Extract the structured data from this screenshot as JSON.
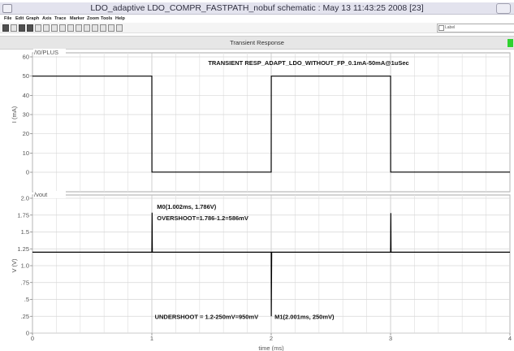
{
  "window": {
    "title": "LDO_adaptive LDO_COMPR_FASTPATH_nobuf schematic : May 13 11:43:25 2008 [23]"
  },
  "menu": [
    "File",
    "Edit",
    "Graph",
    "Axis",
    "Trace",
    "Marker",
    "Zoom",
    "Tools",
    "Help"
  ],
  "toolbar": {
    "label_field": "Label"
  },
  "tab": {
    "title": "Transient Response"
  },
  "chart_data": [
    {
      "type": "line",
      "title": "TRANSIENT RESP_ADAPT_LDO_WITHOUT_FP_0.1mA-50mA@1uSec",
      "trace_name": "/I0/PLUS",
      "ylabel": "I (mA)",
      "ylim": [
        0,
        60
      ],
      "xlim": [
        0,
        4
      ],
      "yticks": [
        "60",
        "50",
        "40",
        "30",
        "20",
        "10",
        "0"
      ],
      "grid": true,
      "series": [
        {
          "name": "/I0/PLUS",
          "x": [
            0,
            0.001,
            1.0,
            1.001,
            2.0,
            2.001,
            3.0,
            3.001,
            4.0
          ],
          "y": [
            50,
            50,
            50,
            0.1,
            0.1,
            50,
            50,
            0.1,
            0.1
          ]
        }
      ]
    },
    {
      "type": "line",
      "trace_name": "/vout",
      "xlabel": "time (ms)",
      "ylabel": "V (V)",
      "ylim": [
        0,
        2.0
      ],
      "xlim": [
        0,
        4
      ],
      "yticks": [
        "2.0",
        "1.75",
        "1.5",
        "1.25",
        "1.0",
        ".75",
        ".5",
        ".25",
        "0"
      ],
      "xticks": [
        "0",
        "1",
        "2",
        "3",
        "4"
      ],
      "grid": true,
      "series": [
        {
          "name": "/vout",
          "x": [
            0,
            0.001,
            1.0,
            1.002,
            1.004,
            2.0,
            2.001,
            2.004,
            3.0,
            3.002,
            3.004,
            4.0
          ],
          "y": [
            1.2,
            1.2,
            1.2,
            1.786,
            1.2,
            1.2,
            0.25,
            1.2,
            1.2,
            1.78,
            1.2,
            1.2
          ]
        }
      ],
      "annotations": [
        {
          "text": "M0(1.002ms, 1.786V)",
          "x": 1.002,
          "y": 1.786
        },
        {
          "text": "OVERSHOOT=1.786-1.2=586mV",
          "x": 1.002,
          "y": 1.786
        },
        {
          "text": "M1(2.001ms, 250mV)",
          "x": 2.001,
          "y": 0.25
        },
        {
          "text": "UNDERSHOOT = 1.2-250mV=950mV",
          "x": 2.001,
          "y": 0.25
        }
      ]
    }
  ]
}
